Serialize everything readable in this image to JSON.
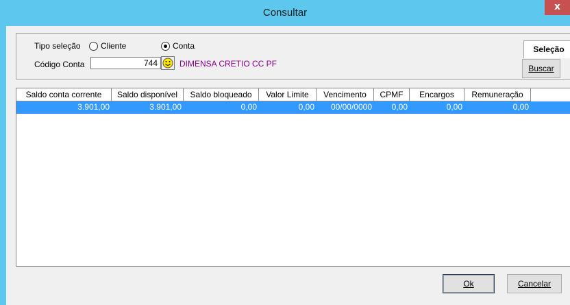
{
  "window": {
    "title": "Consultar",
    "close_label": "x"
  },
  "selecao": {
    "tab_label": "Seleção",
    "tipo_label": "Tipo seleção",
    "options": [
      {
        "label": "Cliente",
        "checked": false
      },
      {
        "label": "Conta",
        "checked": true
      }
    ],
    "codigo_label": "Código Conta",
    "codigo_value": "744",
    "account_name": "DIMENSA CRETIO CC PF",
    "buscar_label": "Buscar"
  },
  "grid": {
    "columns": [
      "Saldo conta corrente",
      "Saldo disponível",
      "Saldo bloqueado",
      "Valor Limite",
      "Vencimento",
      "CPMF",
      "Encargos",
      "Remuneração"
    ],
    "rows": [
      [
        "3.901,00",
        "3.901,00",
        "0,00",
        "0,00",
        "00/00/0000",
        "0,00",
        "0,00",
        "0,00"
      ]
    ]
  },
  "footer": {
    "ok_label": "Ok",
    "cancel_label": "Cancelar"
  },
  "colors": {
    "title_bar": "#5ec7ee",
    "selection": "#3399ff",
    "account_name": "#8b008b",
    "close": "#c75050"
  }
}
